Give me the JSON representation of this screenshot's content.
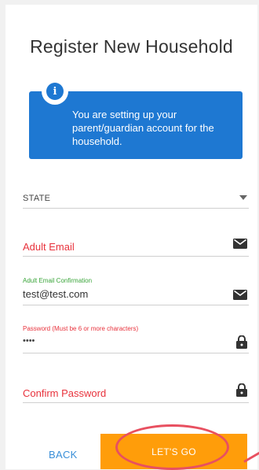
{
  "page": {
    "title": "Register New Household"
  },
  "info": {
    "icon": "info-icon",
    "glyph": "i",
    "text": "You are setting up your parent/guardian account for the household.",
    "color": "#1e78d2"
  },
  "form": {
    "state": {
      "label": "STATE",
      "icon": "chevron-down-icon"
    },
    "adult_email": {
      "label": "Adult Email",
      "icon": "envelope-icon"
    },
    "adult_email_confirmation": {
      "label": "Adult Email Confirmation",
      "value": "test@test.com",
      "icon": "envelope-icon"
    },
    "password": {
      "label": "Password (Must be 6 or more characters)",
      "value": "••••",
      "icon": "lock-icon"
    },
    "confirm_password": {
      "label": "Confirm Password",
      "icon": "lock-icon"
    }
  },
  "actions": {
    "back_label": "BACK",
    "go_label": "LET'S GO",
    "accent": "#ff9d0a",
    "annotation_color": "#e85060"
  }
}
